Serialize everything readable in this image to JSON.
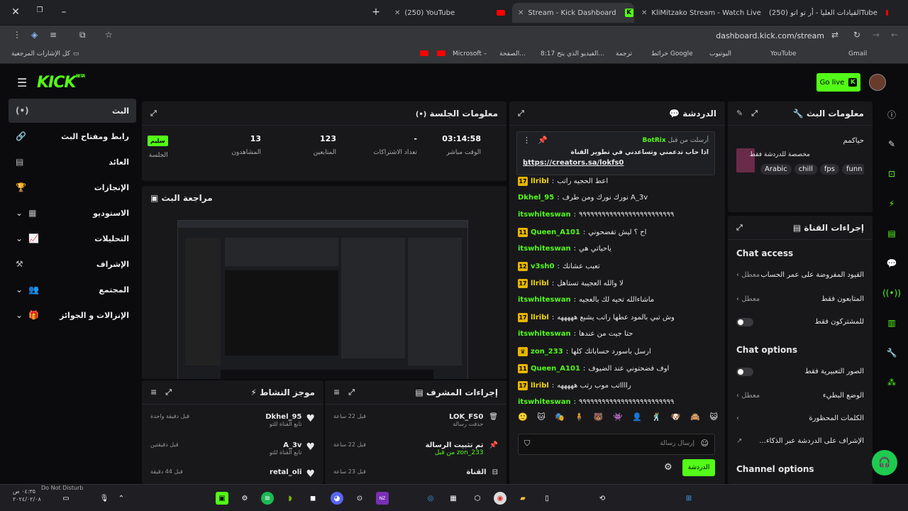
{
  "browser": {
    "tabs": [
      {
        "label": "(250) YouTube"
      },
      {
        "label": "Stream - Kick Dashboard"
      },
      {
        "label": "KliMitzako Stream - Watch Live"
      },
      {
        "label": "(250) القيادات العليا - أر تو اتوTube"
      }
    ],
    "url": "dashboard.kick.com/stream",
    "bookmarks": [
      "كل الإشارات المرجعية",
      "Microsoft –",
      "الصفحة...",
      "8:17 الفيديو الذي يتح...",
      "ترجمة",
      "خرائط Google",
      "اليوتيوب",
      "YouTube",
      "Gmail"
    ]
  },
  "header": {
    "logo": "KICK",
    "beta": "BETA",
    "golive": "Go live"
  },
  "sidebar": [
    {
      "label": "البث",
      "icon": "(•)"
    },
    {
      "label": "رابط ومفتاح البث",
      "icon": "🔗"
    },
    {
      "label": "العائد",
      "icon": "▤"
    },
    {
      "label": "الإنجازات",
      "icon": "🏆"
    },
    {
      "label": "الاستوديو",
      "icon": "▦"
    },
    {
      "label": "التحليلات",
      "icon": "📈"
    },
    {
      "label": "الإشراف",
      "icon": "⚒"
    },
    {
      "label": "المجتمع",
      "icon": "👥"
    },
    {
      "label": "الإنزالات و الجوائز",
      "icon": "🎁"
    }
  ],
  "session": {
    "title": "معلومات الجلسة",
    "stats": [
      {
        "value": "03:14:58",
        "label": "الوقت مباشر"
      },
      {
        "value": "-",
        "label": "تعداد الاشتراكات"
      },
      {
        "value": "123",
        "label": "المتابعين"
      },
      {
        "value": "13",
        "label": "المشاهدون"
      },
      {
        "value": "سليم",
        "label": "الجلسة"
      }
    ]
  },
  "review": {
    "title": "مراجعة البث"
  },
  "activity": {
    "title": "موجز النشاط",
    "items": [
      {
        "user": "Dkhel_95",
        "desc": "تابع القناة للتو",
        "time": "قبل دقيقة واحدة"
      },
      {
        "user": "A_3v",
        "desc": "تابع القناة للتو",
        "time": "قبل دقيقتين"
      },
      {
        "user": "retal_oli",
        "desc": "",
        "time": "قبل 44 دقيقة"
      }
    ]
  },
  "modactions": {
    "title": "إجراءات المشرف",
    "items": [
      {
        "user": "LOK_FS0",
        "desc": "حذفت رسالة",
        "time": "قبل 22 ساعة"
      },
      {
        "user": "تم تثبيت الرسالة",
        "desc": "zon_233 من قبل",
        "time": "قبل 22 ساعة"
      },
      {
        "user": "القناة",
        "desc": "",
        "time": "قبل 23 ساعة"
      }
    ]
  },
  "chat": {
    "title": "الدردشة",
    "pinned": {
      "by": "أرسلت من قبل",
      "user": "BotRix",
      "text": "اذا حاب تدعمني وتساعدني في تطوير القناة",
      "link": "https://creators.sa/lokfs0"
    },
    "messages": [
      {
        "user": "llribl",
        "text": "اعط الحجيه راتب",
        "color": "#f5d90a",
        "badge": "17"
      },
      {
        "user": "Dkhel_95",
        "text": "A_3v نورك نورك ومن طرف",
        "color": "#53fc18",
        "badge": ""
      },
      {
        "user": "itswhiteswan",
        "text": "٩٩٩٩٩٩٩٩٩٩٩٩٩٩٩٩٩٩٩٩٩٩٩٩٩",
        "color": "#53fc18",
        "badge": ""
      },
      {
        "user": "Queen_A101",
        "text": "اح ؟ ليش تفضحوني",
        "color": "#53fc18",
        "badge": "11"
      },
      {
        "user": "itswhiteswan",
        "text": "ياحياتي هي",
        "color": "#53fc18",
        "badge": ""
      },
      {
        "user": "v3sh0",
        "text": "تعبب عشانك",
        "color": "#53fc18",
        "badge": "12"
      },
      {
        "user": "llribl",
        "text": "لا والله العجيبة تستاهل",
        "color": "#f5d90a",
        "badge": "17"
      },
      {
        "user": "itswhiteswan",
        "text": "ماشاءالله تحيه لك بالعجيه",
        "color": "#53fc18",
        "badge": ""
      },
      {
        "user": "llribl",
        "text": "وش تبي بالمود عطها راتب يشبع هههههه",
        "color": "#f5d90a",
        "badge": "17"
      },
      {
        "user": "itswhiteswan",
        "text": "حتا جيت من عندها",
        "color": "#53fc18",
        "badge": ""
      },
      {
        "user": "zon_233",
        "text": "ارسل باسورد حساباتك كلها",
        "color": "#53fc18",
        "badge": "♛"
      },
      {
        "user": "Queen_A101",
        "text": "اوف فضحتوني عند الضيوف",
        "color": "#53fc18",
        "badge": "11"
      },
      {
        "user": "llribl",
        "text": "رااااتب موب رتب هههههه",
        "color": "#f5d90a",
        "badge": "17"
      },
      {
        "user": "itswhiteswan",
        "text": "٩٩٩٩٩٩٩٩٩٩٩٩٩٩٩٩٩٩٩٩٩٩٩٩٩",
        "color": "#53fc18",
        "badge": ""
      }
    ],
    "placeholder": "إرسال رسالة",
    "send": "الدردشة"
  },
  "streaminfo": {
    "title": "معلومات البث",
    "streamtitle": "حياكمم",
    "subtitle": "مخصصة للدردشة فقط",
    "tags": [
      "Arabic",
      "chill",
      "fps",
      "funn"
    ]
  },
  "channel": {
    "title": "إجراءات القناة",
    "chat_access": "Chat access",
    "rows_access": [
      {
        "label": "القيود المفروضة على عمر الحساب",
        "state": "معطل"
      },
      {
        "label": "المتابعون فقط",
        "state": "معطل"
      },
      {
        "label": "للمشتركون فقط",
        "state": ""
      }
    ],
    "chat_options": "Chat options",
    "rows_options": [
      {
        "label": "الصور التعبيرية فقط",
        "state": ""
      },
      {
        "label": "الوضع البطيء",
        "state": "معطل"
      },
      {
        "label": "الكلمات المحظورة",
        "state": ""
      },
      {
        "label": "الإشراف على الدردشة عبر الذكاء...",
        "state": ""
      }
    ],
    "channel_options": "Channel options"
  },
  "taskbar": {
    "dnd": "Do Not Disturb",
    "time": "٠٤:٣٥ ص",
    "date": "٢٠٢٤/٠٢/٠٨"
  }
}
